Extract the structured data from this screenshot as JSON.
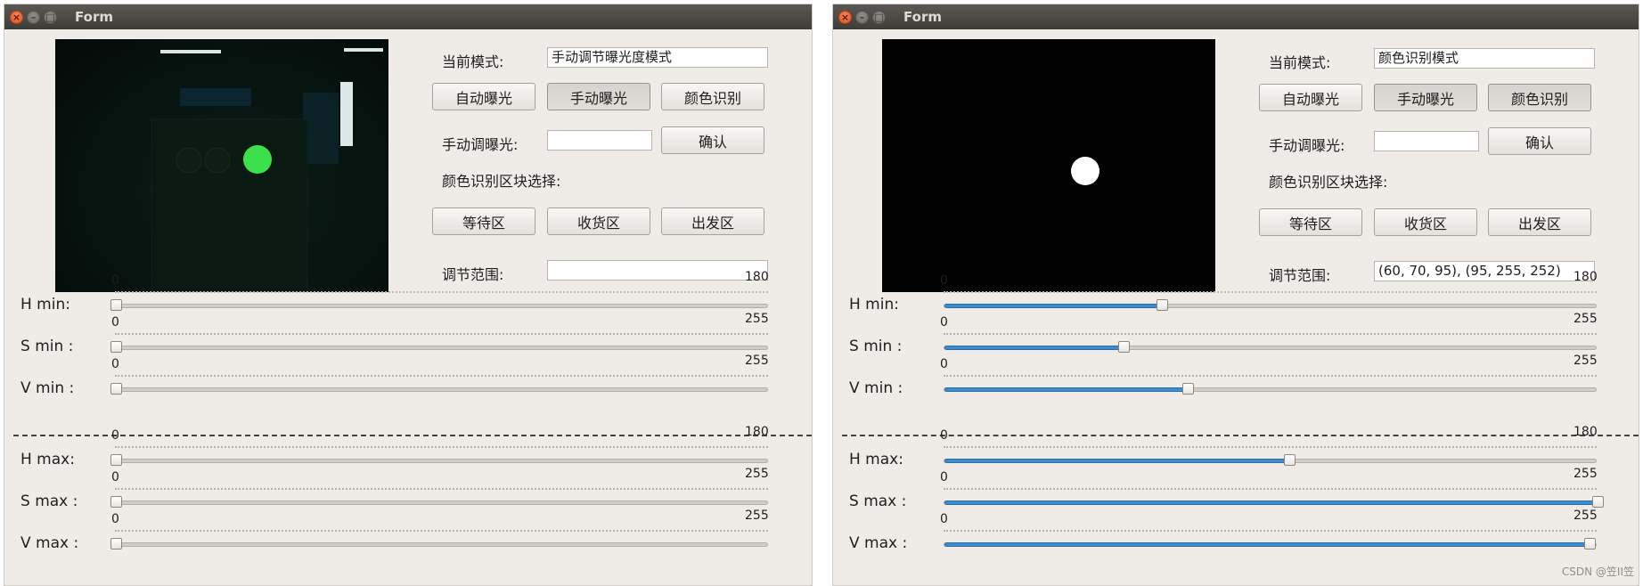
{
  "windows": [
    {
      "title": "Form",
      "mode_label": "当前模式:",
      "mode_value": "手动调节曝光度模式",
      "buttons": {
        "auto_exposure": "自动曝光",
        "manual_exposure": "手动曝光",
        "color_detect": "颜色识别"
      },
      "manual_exposure_label": "手动调曝光:",
      "manual_exposure_value": "",
      "confirm_label": "确认",
      "region_label": "颜色识别区块选择:",
      "regions": {
        "waiting": "等待区",
        "receiving": "收货区",
        "departure": "出发区"
      },
      "range_label": "调节范围:",
      "range_value": "",
      "camera": "green-ball-camera-view",
      "sliders": [
        {
          "label": "H  min:",
          "min": "0",
          "max": "180",
          "value": 0,
          "range": 180
        },
        {
          "label": "S  min :",
          "min": "0",
          "max": "255",
          "value": 0,
          "range": 255
        },
        {
          "label": "V  min :",
          "min": "0",
          "max": "255",
          "value": 0,
          "range": 255
        },
        {
          "label": "H  max:",
          "min": "0",
          "max": "180",
          "value": 0,
          "range": 180
        },
        {
          "label": "S  max :",
          "min": "0",
          "max": "255",
          "value": 0,
          "range": 255
        },
        {
          "label": "V  max :",
          "min": "0",
          "max": "255",
          "value": 0,
          "range": 255
        }
      ]
    },
    {
      "title": "Form",
      "mode_label": "当前模式:",
      "mode_value": "颜色识别模式",
      "buttons": {
        "auto_exposure": "自动曝光",
        "manual_exposure": "手动曝光",
        "color_detect": "颜色识别"
      },
      "manual_exposure_label": "手动调曝光:",
      "manual_exposure_value": "",
      "confirm_label": "确认",
      "region_label": "颜色识别区块选择:",
      "regions": {
        "waiting": "等待区",
        "receiving": "收货区",
        "departure": "出发区"
      },
      "range_label": "调节范围:",
      "range_value": "(60, 70, 95), (95, 255, 252)",
      "camera": "binary-mask-view",
      "sliders": [
        {
          "label": "H  min:",
          "min": "0",
          "max": "180",
          "value": 60,
          "range": 180
        },
        {
          "label": "S  min :",
          "min": "0",
          "max": "255",
          "value": 70,
          "range": 255
        },
        {
          "label": "V  min :",
          "min": "0",
          "max": "255",
          "value": 95,
          "range": 255
        },
        {
          "label": "H  max:",
          "min": "0",
          "max": "180",
          "value": 95,
          "range": 180
        },
        {
          "label": "S  max :",
          "min": "0",
          "max": "255",
          "value": 255,
          "range": 255
        },
        {
          "label": "V  max :",
          "min": "0",
          "max": "255",
          "value": 252,
          "range": 255
        }
      ]
    }
  ],
  "watermark": "CSDN @笠II笠",
  "colors": {
    "accent": "#3d8ccf",
    "titlebar": "#3d3c38",
    "window_bg": "#efece8",
    "close_button": "#e2531f",
    "ball_green": "#3be04a"
  }
}
